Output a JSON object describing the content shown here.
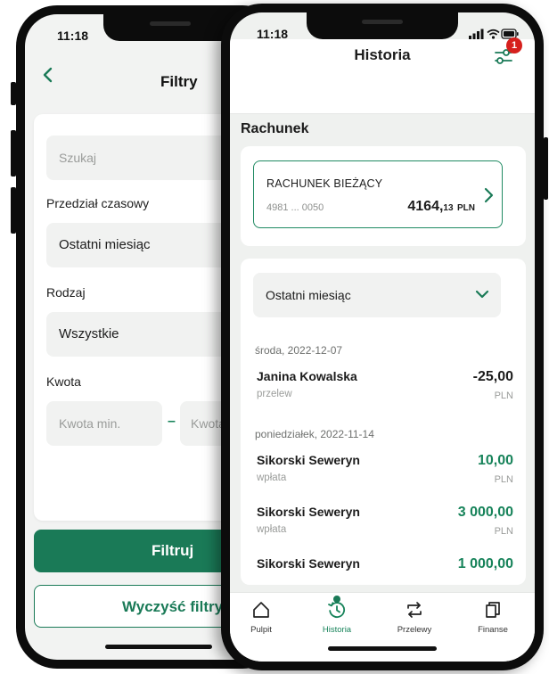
{
  "back_screen": {
    "status_time": "11:18",
    "header": {
      "title": "Filtry"
    },
    "search": {
      "placeholder": "Szukaj"
    },
    "period": {
      "label": "Przedział czasowy",
      "value": "Ostatni miesiąc"
    },
    "kind": {
      "label": "Rodzaj",
      "value": "Wszystkie"
    },
    "amount": {
      "label": "Kwota",
      "min_placeholder": "Kwota min.",
      "separator": "–",
      "max_placeholder": "Kwota"
    },
    "buttons": {
      "apply": "Filtruj",
      "clear": "Wyczyść filtry"
    }
  },
  "front_screen": {
    "status_time": "11:18",
    "header": {
      "title": "Historia",
      "filter_badge": "1"
    },
    "section_title": "Rachunek",
    "account": {
      "name": "RACHUNEK BIEŻĄCY",
      "number": "4981 ... 0050",
      "balance_main": "4164,",
      "balance_fraction": "13",
      "currency": "PLN"
    },
    "period_select": {
      "value": "Ostatni miesiąc"
    },
    "groups": [
      {
        "date": "środa, 2022-12-07",
        "transactions": [
          {
            "name": "Janina Kowalska",
            "type": "przelew",
            "amount": "-25,00",
            "currency": "PLN"
          }
        ]
      },
      {
        "date": "poniedziałek, 2022-11-14",
        "transactions": [
          {
            "name": "Sikorski Seweryn",
            "type": "wpłata",
            "amount": "10,00",
            "currency": "PLN"
          },
          {
            "name": "Sikorski Seweryn",
            "type": "wpłata",
            "amount": "3 000,00",
            "currency": "PLN"
          },
          {
            "name": "Sikorski Seweryn",
            "type": "",
            "amount": "1 000,00",
            "currency": ""
          }
        ]
      }
    ],
    "tabs": [
      {
        "label": "Pulpit",
        "icon": "home-icon"
      },
      {
        "label": "Historia",
        "icon": "history-icon",
        "active": true
      },
      {
        "label": "Przelewy",
        "icon": "transfer-icon"
      },
      {
        "label": "Finanse",
        "icon": "finance-icon"
      }
    ]
  },
  "colors": {
    "brand_green": "#1a7a57",
    "positive_amount": "#17835a",
    "badge_red": "#d6201d"
  }
}
